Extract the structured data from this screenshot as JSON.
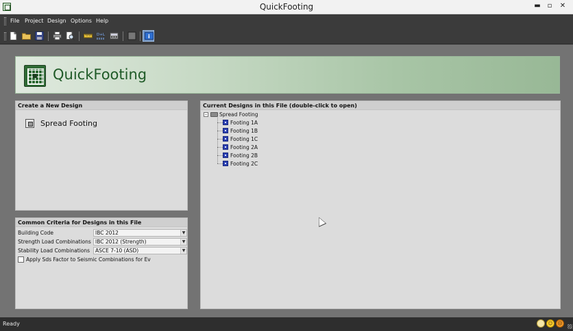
{
  "window": {
    "title": "QuickFooting"
  },
  "menu": {
    "items": [
      "File",
      "Project",
      "Design",
      "Options",
      "Help"
    ]
  },
  "toolbar": {
    "buttons": [
      {
        "icon": "new-file-icon"
      },
      {
        "icon": "open-folder-icon"
      },
      {
        "icon": "save-icon"
      },
      {
        "icon": "print-icon"
      },
      {
        "icon": "print-preview-icon"
      },
      {
        "icon": "ruler-icon"
      },
      {
        "icon": "d-plus-l-icon"
      },
      {
        "icon": "calculator-icon"
      },
      {
        "icon": "stop-icon"
      },
      {
        "icon": "info-icon"
      }
    ]
  },
  "banner": {
    "brand": "QuickFooting"
  },
  "create": {
    "title": "Create a New Design",
    "item": {
      "label": "Spread Footing",
      "icon": "footing-icon"
    }
  },
  "criteria": {
    "title": "Common Criteria for Designs in this File",
    "rows": [
      {
        "label": "Building Code",
        "value": "IBC 2012"
      },
      {
        "label": "Strength Load Combinations",
        "value": "IBC 2012 (Strength)"
      },
      {
        "label": "Stability Load Combinations",
        "value": "ASCE 7-10 (ASD)"
      }
    ],
    "checkbox": {
      "label": "Apply Sds Factor to Seismic Combinations for Ev",
      "checked": false
    }
  },
  "designs": {
    "title": "Current Designs in this File (double-click to open)",
    "root": "Spread Footing",
    "items": [
      "Footing 1A",
      "Footing 1B",
      "Footing 1C",
      "Footing 2A",
      "Footing 2B",
      "Footing 2C"
    ]
  },
  "status": {
    "text": "Ready"
  },
  "colors": {
    "banner_text": "#1f5a27",
    "tree_icon": "#2a3fb0",
    "chrome": "#3b3b3b"
  }
}
